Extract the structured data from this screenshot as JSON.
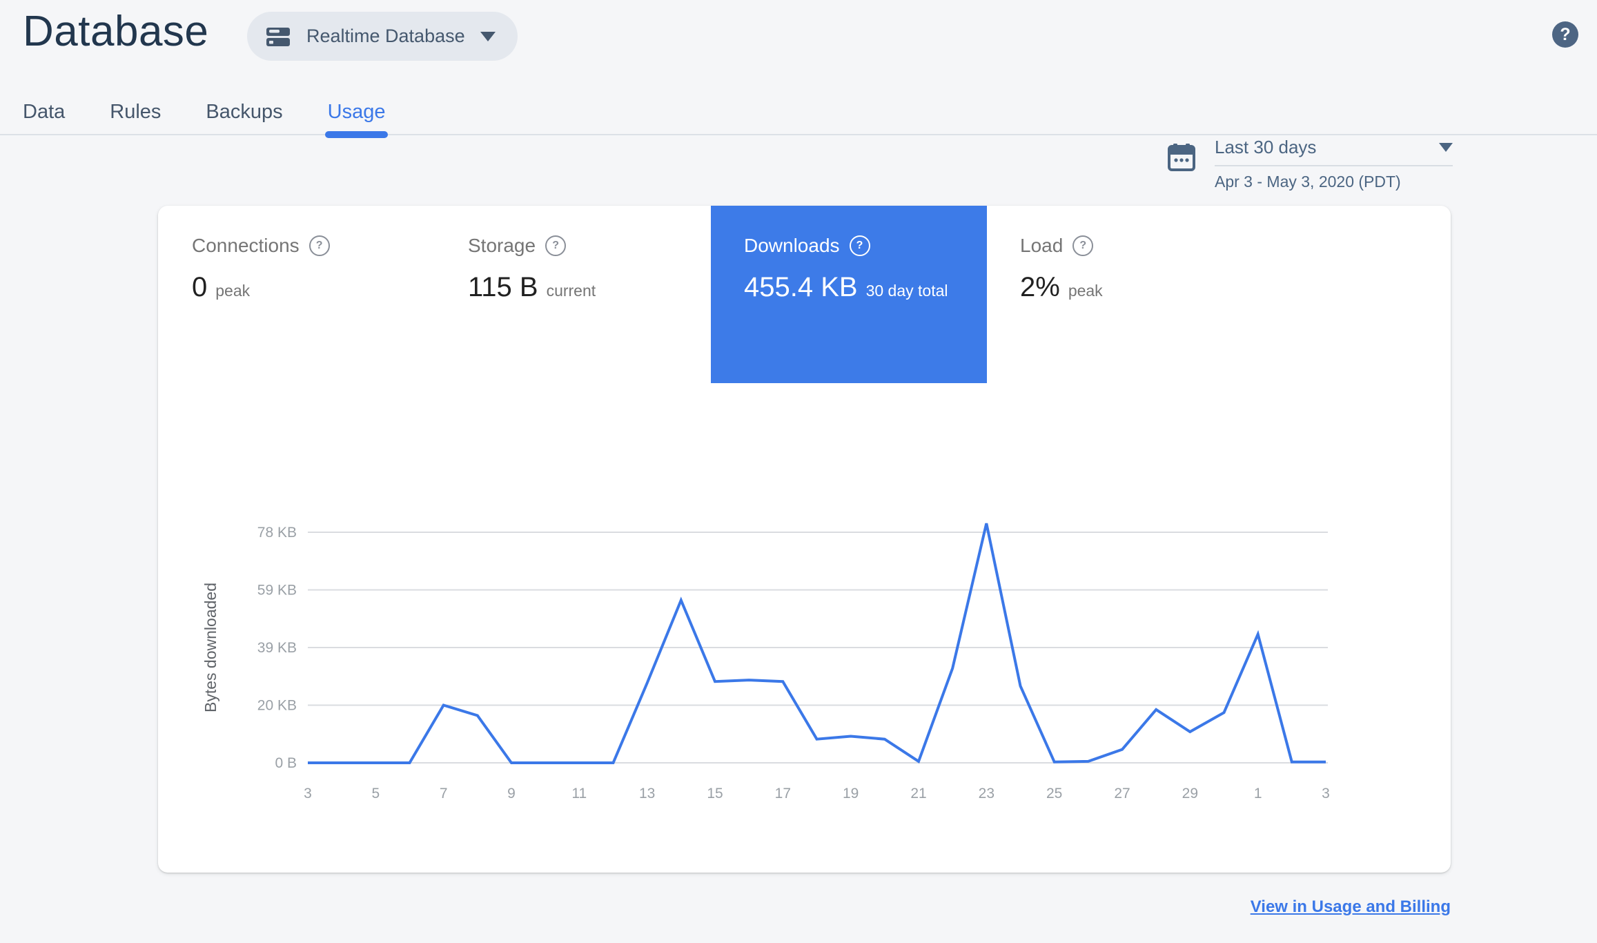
{
  "page": {
    "background": "#f5f6f8"
  },
  "header": {
    "title": "Database",
    "instance_selector": {
      "label": "Realtime Database"
    },
    "help_label": "?"
  },
  "tabs": [
    {
      "label": "Data",
      "active": false
    },
    {
      "label": "Rules",
      "active": false
    },
    {
      "label": "Backups",
      "active": false
    },
    {
      "label": "Usage",
      "active": true
    }
  ],
  "date_range": {
    "preset": "Last 30 days",
    "detail": "Apr 3 - May 3, 2020 (PDT)"
  },
  "metrics": [
    {
      "label": "Connections",
      "help": "?",
      "value": "0",
      "unit": "peak",
      "active": false
    },
    {
      "label": "Storage",
      "help": "?",
      "value": "115 B",
      "unit": "current",
      "active": false
    },
    {
      "label": "Downloads",
      "help": "?",
      "value": "455.4 KB",
      "unit": "30 day total",
      "active": true
    },
    {
      "label": "Load",
      "help": "?",
      "value": "2%",
      "unit": "peak",
      "active": false
    }
  ],
  "footer": {
    "link_label": "View in Usage and Billing"
  },
  "colors": {
    "accent": "#3b78e8",
    "active_metric_bg": "#3d7be8",
    "slate": "#4b6582",
    "title": "#22374e",
    "tab_inactive": "#45566b"
  },
  "chart_data": {
    "type": "line",
    "title": "Downloads - bytes downloaded per day",
    "ylabel": "Bytes downloaded",
    "xlabel": "",
    "x_days": [
      3,
      4,
      5,
      6,
      7,
      8,
      9,
      10,
      11,
      12,
      13,
      14,
      15,
      16,
      17,
      18,
      19,
      20,
      21,
      22,
      23,
      24,
      25,
      26,
      27,
      28,
      29,
      30,
      1,
      2,
      3
    ],
    "values_kb": [
      0,
      0,
      0,
      0,
      19.5,
      16,
      0,
      0,
      0,
      0,
      27,
      55,
      27.5,
      28,
      27.5,
      8,
      9,
      8,
      0.5,
      32,
      81,
      26,
      0.3,
      0.5,
      4.5,
      18,
      10.5,
      17,
      43.5,
      0.3,
      0.3
    ],
    "x_tick_labels": [
      "3",
      "5",
      "7",
      "9",
      "11",
      "13",
      "15",
      "17",
      "19",
      "21",
      "23",
      "25",
      "27",
      "29",
      "1",
      "3"
    ],
    "y_ticks": [
      {
        "label": "0 B",
        "kb": 0
      },
      {
        "label": "20 KB",
        "kb": 19.5
      },
      {
        "label": "39 KB",
        "kb": 39
      },
      {
        "label": "59 KB",
        "kb": 58.5
      },
      {
        "label": "78 KB",
        "kb": 78
      }
    ],
    "y_max": 78,
    "ylim": [
      0,
      81
    ],
    "grid": true,
    "legend": false,
    "total": "455.4 KB",
    "period": "Apr 3 - May 3, 2020 (PDT)",
    "line_color": "#3b78e8",
    "grid_color": "#dadce0",
    "tick_color": "#9aa0a6",
    "ylabel_color": "#5f6368"
  }
}
